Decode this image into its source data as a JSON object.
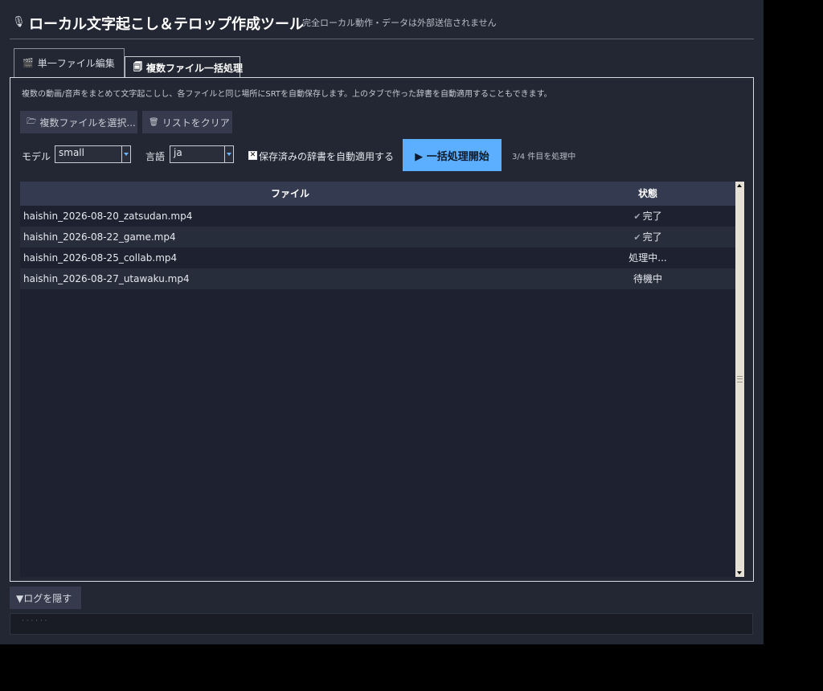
{
  "app": {
    "icon": "microphone-icon",
    "title": "ローカル文字起こし＆テロップ作成ツール",
    "subtitle": "完全ローカル動作・データは外部送信されません"
  },
  "tabs": [
    {
      "icon": "clapperboard-icon",
      "label": "単一ファイル編集",
      "active": false
    },
    {
      "icon": "file-stack-icon",
      "label": "複数ファイル一括処理",
      "active": true
    }
  ],
  "batch": {
    "description": "複数の動画/音声をまとめて文字起こしし、各ファイルと同じ場所にSRTを自動保存します。上のタブで作った辞書を自動適用することもできます。",
    "select_button": "複数ファイルを選択...",
    "clear_button": "リストをクリア",
    "model_label": "モデル",
    "model_value": "small",
    "language_label": "言語",
    "language_value": "ja",
    "auto_dict_checked": true,
    "auto_dict_label": "保存済みの辞書を自動適用する",
    "start_button": "▶ 一括処理開始",
    "progress_text": "3/4 件目を処理中",
    "accent_color": "#5caeff"
  },
  "table": {
    "headers": {
      "file": "ファイル",
      "status": "状態"
    },
    "rows": [
      {
        "file": "haishin_2026-08-20_zatsudan.mp4",
        "status": "完了",
        "done": true
      },
      {
        "file": "haishin_2026-08-22_game.mp4",
        "status": "完了",
        "done": true
      },
      {
        "file": "haishin_2026-08-25_collab.mp4",
        "status": "処理中...",
        "done": false
      },
      {
        "file": "haishin_2026-08-27_utawaku.mp4",
        "status": "待機中",
        "done": false
      }
    ]
  },
  "log": {
    "toggle_label": "▼ログを隠す"
  }
}
